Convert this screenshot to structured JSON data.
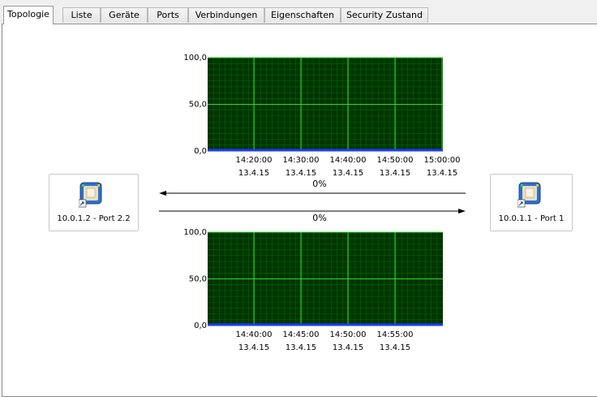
{
  "tabs": [
    {
      "label": "Topologie",
      "active": true
    },
    {
      "label": "Liste",
      "active": false
    },
    {
      "label": "Geräte",
      "active": false
    },
    {
      "label": "Ports",
      "active": false
    },
    {
      "label": "Verbindungen",
      "active": false
    },
    {
      "label": "Eigenschaften",
      "active": false
    },
    {
      "label": "Security Zustand",
      "active": false
    }
  ],
  "nodes": {
    "left": {
      "label": "10.0.1.2 - Port 2.2",
      "icon": "network-port-icon"
    },
    "right": {
      "label": "10.0.1.1 - Port 1",
      "icon": "network-port-icon"
    }
  },
  "links": {
    "top_percent": "0%",
    "bottom_percent": "0%"
  },
  "colors": {
    "chart_bg": "#003300",
    "grid_minor": "#006b00",
    "grid_major": "#2ae02a",
    "baseline": "#1b3cff"
  },
  "chart_data": [
    {
      "type": "line",
      "y_ticks": [
        "100,0",
        "50,0",
        "0,0"
      ],
      "ylim": [
        0,
        100
      ],
      "x_ticks": [
        {
          "time": "14:20:00",
          "date": "13.4.15"
        },
        {
          "time": "14:30:00",
          "date": "13.4.15"
        },
        {
          "time": "14:40:00",
          "date": "13.4.15"
        },
        {
          "time": "14:50:00",
          "date": "13.4.15"
        },
        {
          "time": "15:00:00",
          "date": "13.4.15"
        }
      ],
      "series": [
        {
          "values": [
            0,
            0,
            0,
            0,
            0,
            0
          ]
        }
      ]
    },
    {
      "type": "line",
      "y_ticks": [
        "100,0",
        "50,0",
        "0,0"
      ],
      "ylim": [
        0,
        100
      ],
      "x_ticks": [
        {
          "time": "14:40:00",
          "date": "13.4.15"
        },
        {
          "time": "14:45:00",
          "date": "13.4.15"
        },
        {
          "time": "14:50:00",
          "date": "13.4.15"
        },
        {
          "time": "14:55:00",
          "date": "13.4.15"
        }
      ],
      "series": [
        {
          "values": [
            0,
            0,
            0,
            0,
            0,
            0
          ]
        }
      ]
    }
  ]
}
